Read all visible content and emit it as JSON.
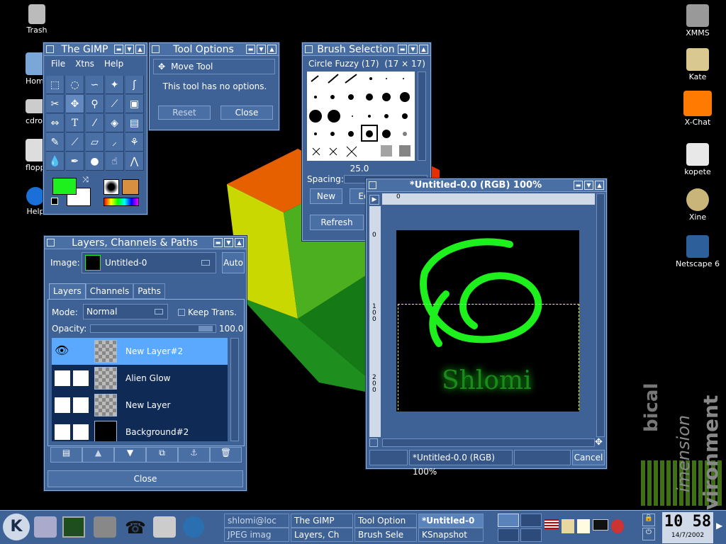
{
  "desktop_icons_left": [
    {
      "label": "Trash",
      "icon": "trash-icon"
    },
    {
      "label": "Hom",
      "icon": "home-icon"
    },
    {
      "label": "cdron",
      "icon": "cdrom-icon"
    },
    {
      "label": "flopp",
      "icon": "floppy-icon"
    },
    {
      "label": "Help",
      "icon": "help-icon"
    }
  ],
  "desktop_icons_right": [
    {
      "label": "XMMS",
      "icon": "xmms-icon"
    },
    {
      "label": "Kate",
      "icon": "kate-icon"
    },
    {
      "label": "X-Chat",
      "icon": "xchat-icon"
    },
    {
      "label": "kopete",
      "icon": "kopete-icon"
    },
    {
      "label": "Xine",
      "icon": "xine-icon"
    },
    {
      "label": "Netscape 6",
      "icon": "netscape-icon"
    }
  ],
  "watermark": {
    "line1": "bical",
    "line2": "imension",
    "line3": "vironment"
  },
  "gimp_toolbox": {
    "title": "The GIMP",
    "menu": [
      "File",
      "Xtns",
      "Help"
    ]
  },
  "tool_options": {
    "title": "Tool Options",
    "tool_name": "Move Tool",
    "message": "This tool has no options.",
    "reset": "Reset",
    "close": "Close"
  },
  "brush_selection": {
    "title": "Brush Selection",
    "brush_name": "Circle Fuzzy (17)",
    "brush_size": "(17 × 17)",
    "spacing_value": "25.0",
    "spacing_label": "Spacing:",
    "new": "New",
    "edit": "Ed",
    "refresh": "Refresh"
  },
  "layers_dialog": {
    "title": "Layers, Channels & Paths",
    "image_label": "Image:",
    "image_value": "Untitled-0",
    "auto": "Auto",
    "tabs": [
      "Layers",
      "Channels",
      "Paths"
    ],
    "mode_label": "Mode:",
    "mode_value": "Normal",
    "keep_trans": "Keep Trans.",
    "opacity_label": "Opacity:",
    "opacity_value": "100.0",
    "layers": [
      {
        "name": "New Layer#2",
        "selected": true
      },
      {
        "name": "Alien Glow",
        "selected": false
      },
      {
        "name": "New Layer",
        "selected": false
      },
      {
        "name": "Background#2",
        "selected": false
      }
    ],
    "close": "Close"
  },
  "image_window": {
    "title": "*Untitled-0.0 (RGB) 100%",
    "status": "*Untitled-0.0 (RGB) 100%",
    "cancel": "Cancel",
    "ruler_top": "0",
    "ruler_left": [
      "0",
      "100",
      "200"
    ],
    "canvas_text": "Shlomi"
  },
  "taskbar": {
    "tasks": [
      "shlomi@loc",
      "The GIMP",
      "Tool Option",
      "*Untitled-0",
      "JPEG imag",
      "Layers, Ch",
      "Brush Sele",
      "KSnapshot"
    ],
    "clock_time": "10 58",
    "clock_date": "14/7/2002"
  },
  "colors": {
    "panel": "#3e6196",
    "titlebar": "#4a6fa5",
    "selected_layer": "#5ba8ff",
    "fg_color": "#1ef01e",
    "bg_color": "#ffffff"
  }
}
